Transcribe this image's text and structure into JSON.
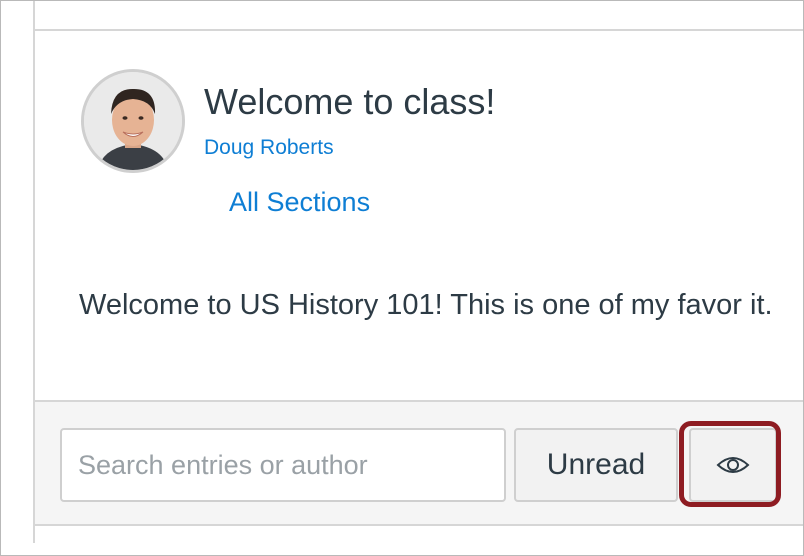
{
  "announcement": {
    "title": "Welcome to class!",
    "author": "Doug Roberts",
    "sections_link": "All Sections",
    "body": "Welcome to US History 101! This is one of my favor it."
  },
  "toolbar": {
    "search_placeholder": "Search entries or author",
    "search_value": "",
    "unread_label": "Unread",
    "mark_read_icon": "eye-icon"
  },
  "colors": {
    "link": "#0e7ed4",
    "text": "#2d3b45",
    "highlight": "#8e1c22",
    "toolbar_bg": "#f5f5f5"
  }
}
